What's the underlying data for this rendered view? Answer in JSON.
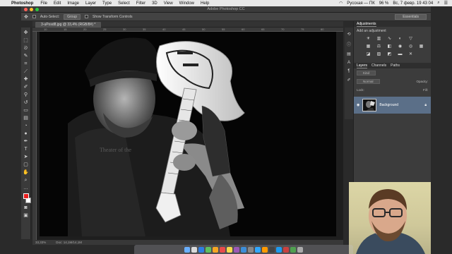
{
  "menubar": {
    "app": "Photoshop",
    "items": [
      "File",
      "Edit",
      "Image",
      "Layer",
      "Type",
      "Select",
      "Filter",
      "3D",
      "View",
      "Window",
      "Help"
    ],
    "keyboard": "Русская — ПК",
    "battery": "96 %",
    "datetime": "Вс, 7 февр.  19 43 04"
  },
  "titlebar": {
    "title": "Adobe Photoshop CC"
  },
  "options": {
    "auto_select_label": "Auto-Select:",
    "auto_select_value": "Group",
    "transform_label": "Show Transform Controls",
    "workspace": "Essentials"
  },
  "document": {
    "tab_label": "3-uPosd8.jpg @ 33,4% (RGB/8#) *"
  },
  "ruler_ticks": [
    "10",
    "15",
    "20",
    "25",
    "30",
    "35",
    "40",
    "45",
    "50",
    "55",
    "60",
    "65",
    "70",
    "75",
    "80"
  ],
  "status": {
    "zoom": "33,33%",
    "doc": "Doc: 14,1M/14,1M"
  },
  "panels": {
    "adjustments_tab": "Adjustments",
    "add_adjustment": "Add an adjustment",
    "layers_tabs": [
      "Layers",
      "Channels",
      "Paths"
    ],
    "kind": "Kind",
    "mode": "Normal",
    "opacity_label": "Opacity:",
    "lock_label": "Lock:",
    "fill_label": "Fill:",
    "layer_name": "Background"
  },
  "colors": {
    "foreground": "#e81e1e",
    "background": "#ffffff",
    "layer_selected": "#5b6f88"
  }
}
